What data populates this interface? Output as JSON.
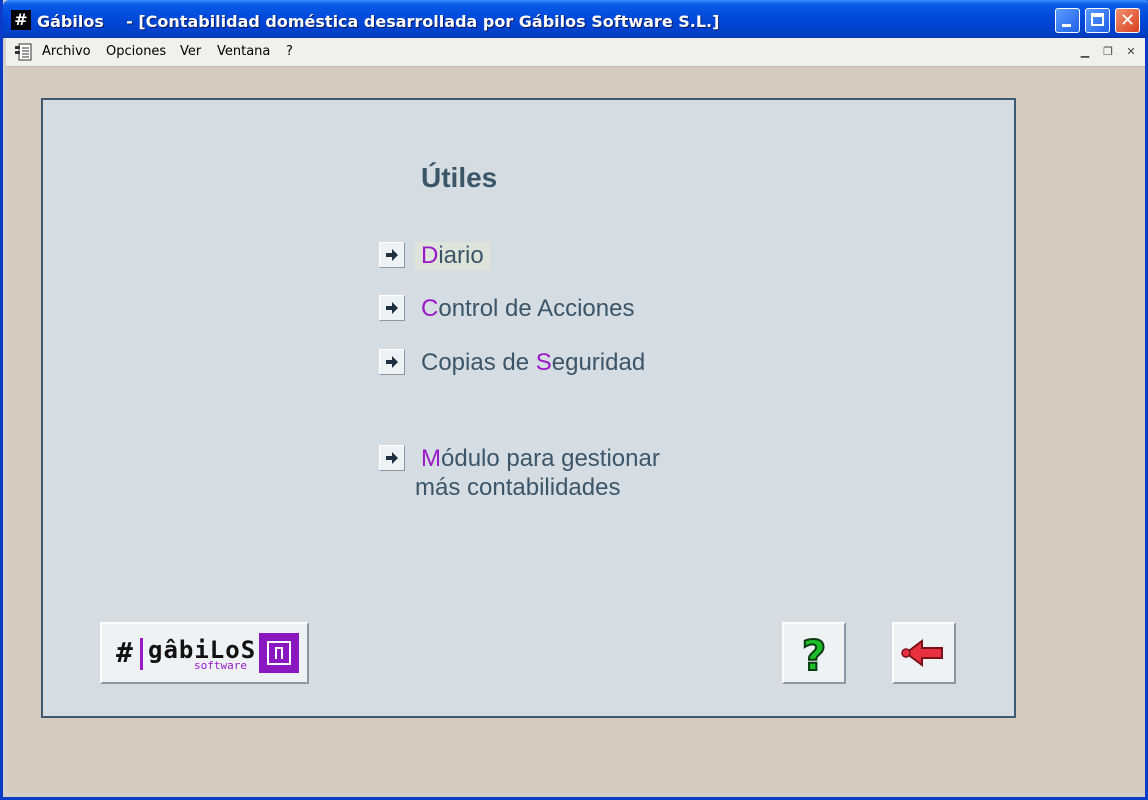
{
  "window": {
    "title": "Gábilos    - [Contabilidad doméstica desarrollada por Gábilos Software S.L.]",
    "app_icon": "#"
  },
  "menubar": {
    "items": [
      "Archivo",
      "Opciones",
      "Ver",
      "Ventana",
      "?"
    ]
  },
  "panel": {
    "heading": "Útiles",
    "options": [
      {
        "hotkey": "D",
        "rest": "iario",
        "pre": ""
      },
      {
        "hotkey": "C",
        "rest": "ontrol de Acciones",
        "pre": ""
      },
      {
        "pre": "Copias de ",
        "hotkey": "S",
        "rest": "eguridad"
      },
      {
        "hotkey": "M",
        "rest": "ódulo para gestionar",
        "line2": "más contabilidades",
        "pre": ""
      }
    ],
    "logo": {
      "hash": "#",
      "name": "gâbiLoS",
      "sub": "software"
    }
  },
  "colors": {
    "accent": "#9a18c8",
    "text": "#3b5569",
    "panel_bg": "#d5dde3"
  },
  "icons": {
    "help": "question-mark-icon",
    "back": "back-arrow-icon",
    "option": "arrow-right-icon"
  }
}
